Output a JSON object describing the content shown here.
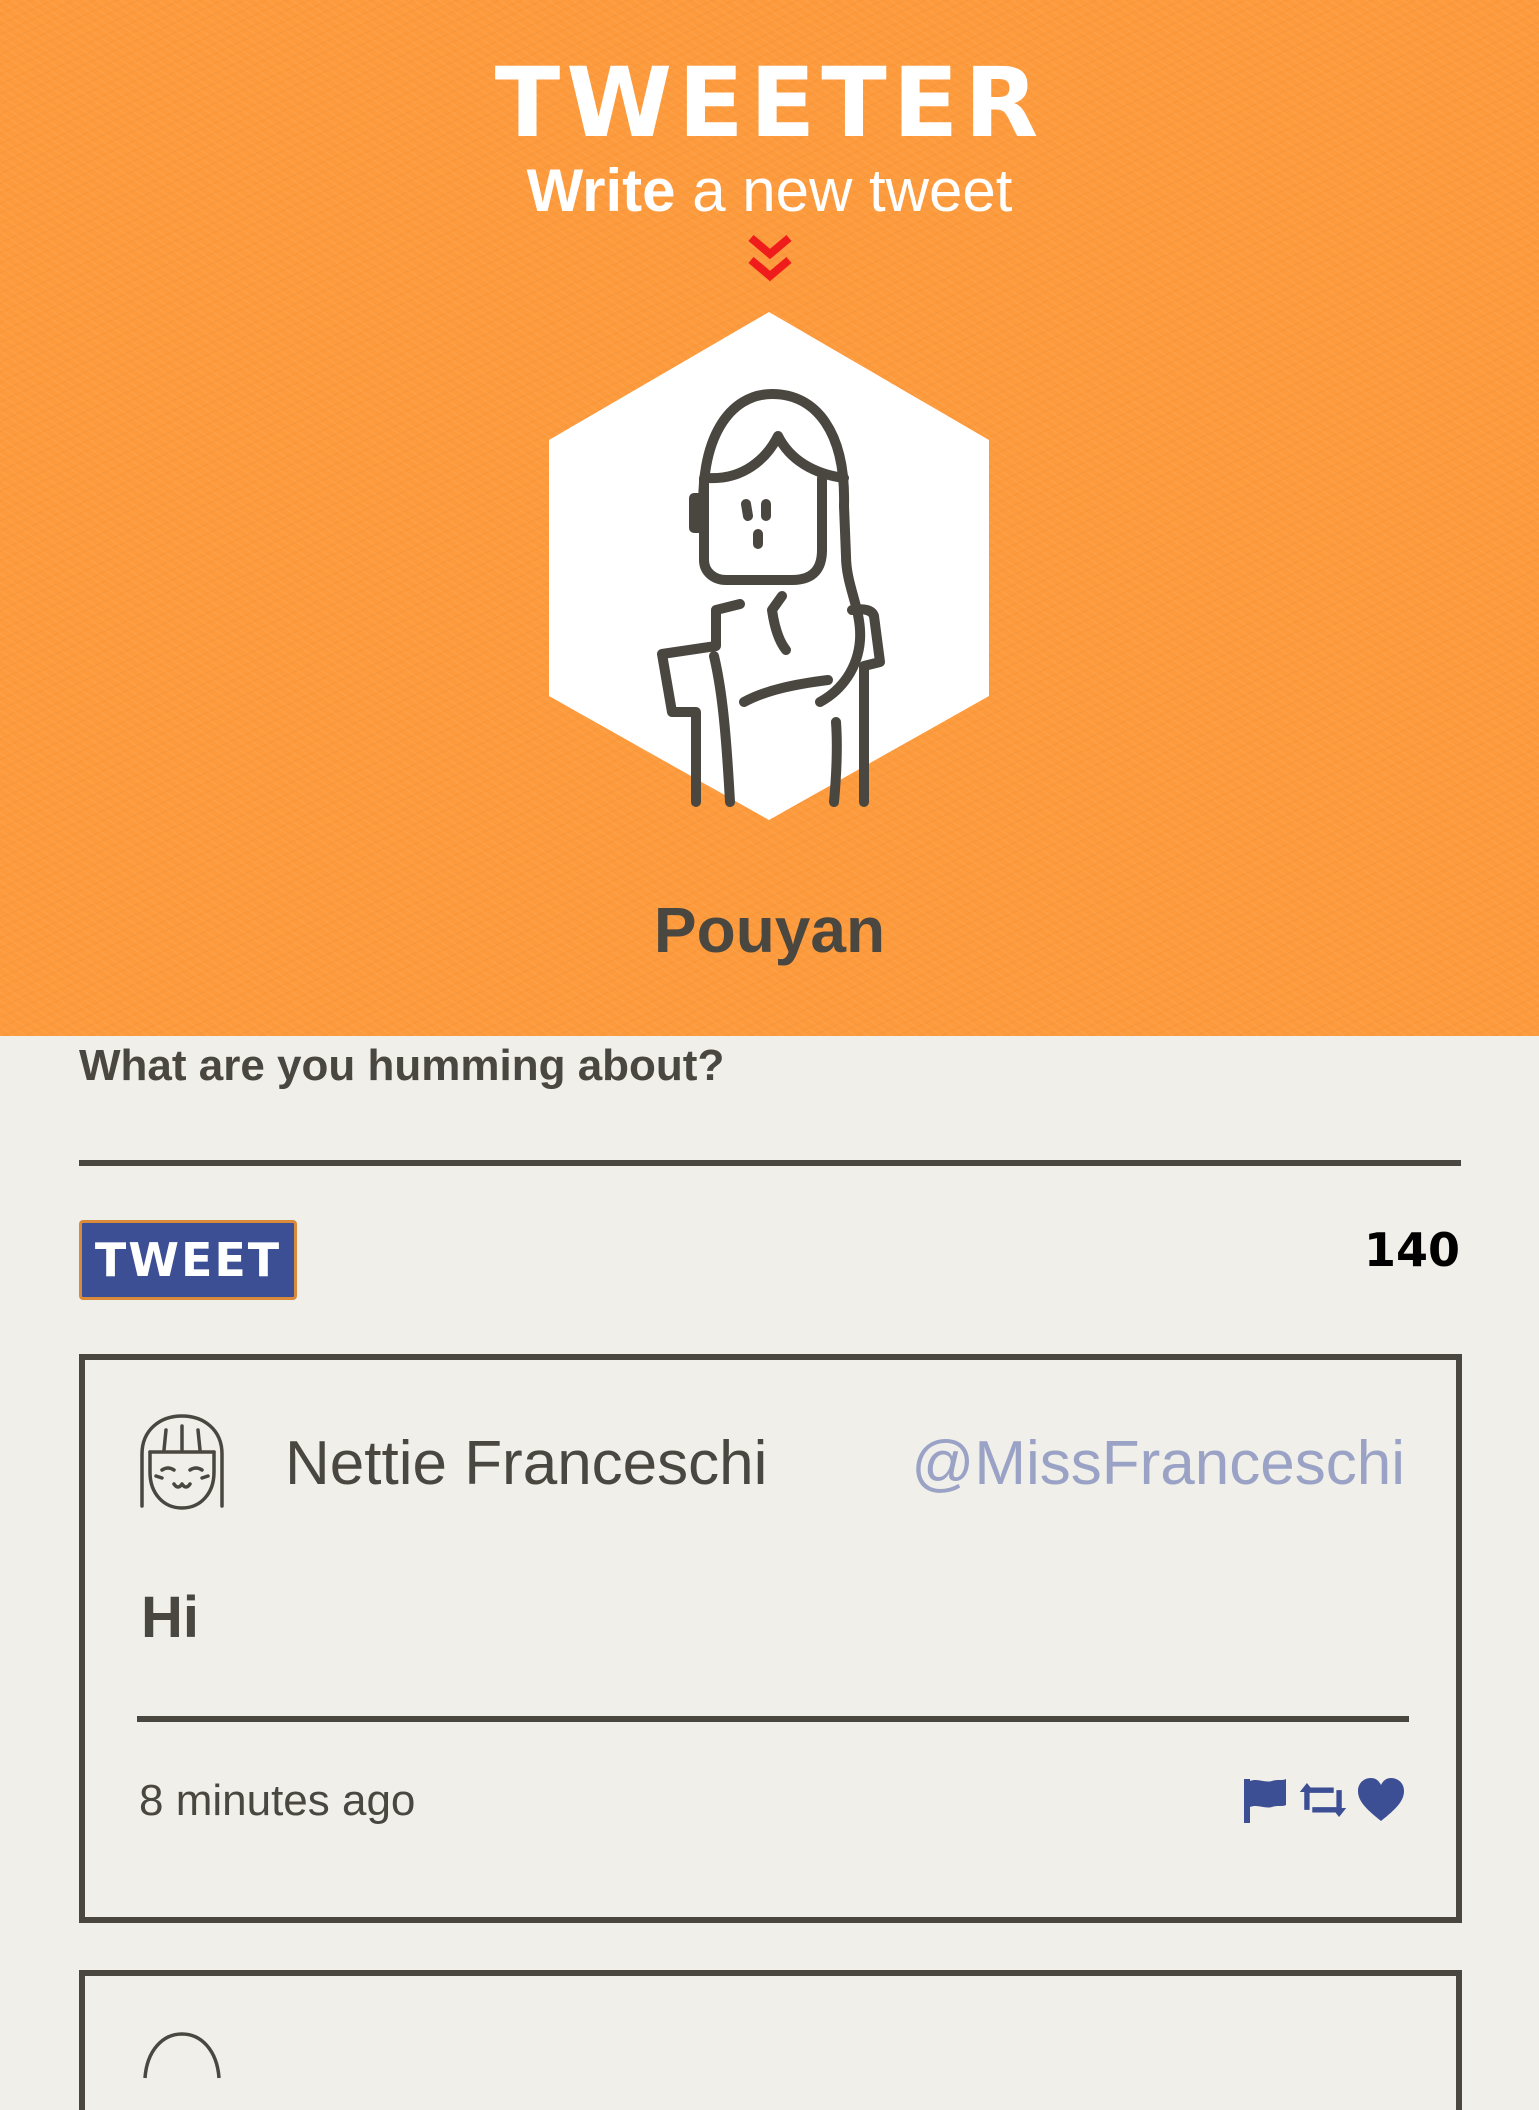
{
  "app": {
    "brand": "TWEETER",
    "subtitle_strong": "Write",
    "subtitle_rest": " a new tweet"
  },
  "profile": {
    "name": "Pouyan"
  },
  "compose": {
    "prompt": "What are you humming about?",
    "button_label": "TWEET",
    "char_count": "140"
  },
  "tweets": [
    {
      "name": "Nettie Franceschi",
      "handle": "@MissFranceschi",
      "content": "Hi",
      "time": "8 minutes ago",
      "actions": [
        "flag-icon",
        "retweet-icon",
        "heart-icon"
      ]
    }
  ],
  "colors": {
    "header_bg": "#fc9a3c",
    "page_bg": "#f1efe9",
    "accent_blue": "#3c4e94",
    "handle_color": "#9aa2c6",
    "chevron_red": "#f01c1c",
    "text_dark": "#4a4640"
  }
}
